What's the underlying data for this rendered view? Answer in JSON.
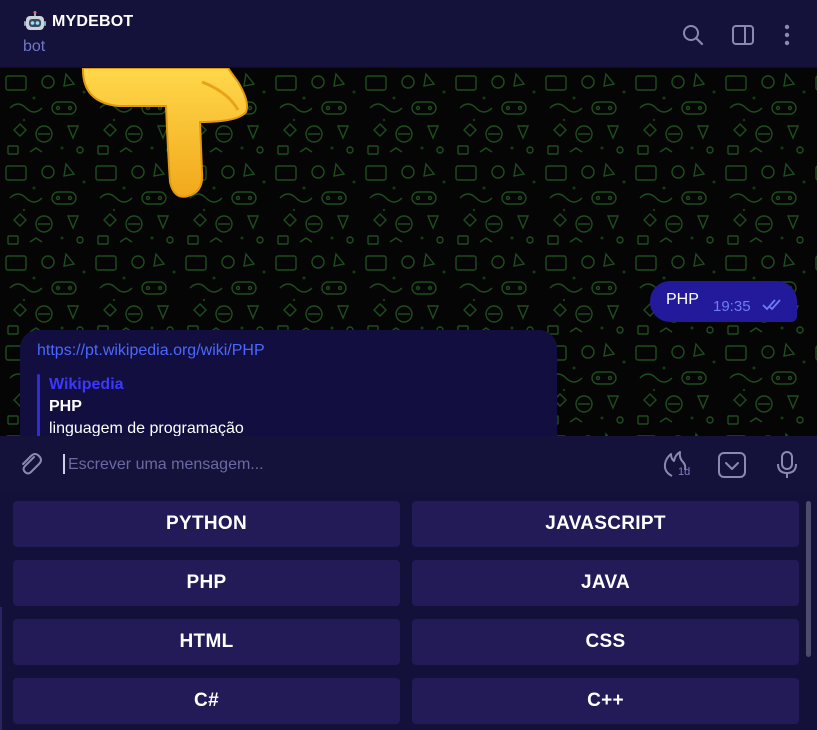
{
  "header": {
    "title": "MYDEBOT",
    "subtitle": "bot",
    "icons": [
      "robot-emoji",
      "search-icon",
      "sidebar-toggle-icon",
      "more-vertical-icon"
    ]
  },
  "chat": {
    "outgoing": {
      "text": "PHP",
      "time": "19:35",
      "status": "read"
    },
    "incoming": {
      "link": "https://pt.wikipedia.org/wiki/PHP",
      "preview_site": "Wikipedia",
      "preview_title": "PHP",
      "preview_description": "linguagem de programação"
    }
  },
  "composer": {
    "placeholder": "Escrever uma mensagem...",
    "timer_label": "1d",
    "icons": [
      "paperclip-icon",
      "self-destruct-timer-icon",
      "bot-keyboard-icon",
      "microphone-icon"
    ]
  },
  "keyboard": {
    "buttons": [
      "PYTHON",
      "JAVASCRIPT",
      "PHP",
      "JAVA",
      "HTML",
      "CSS",
      "C#",
      "C++"
    ]
  },
  "colors": {
    "header_bg": "#14123a",
    "outgoing_bubble": "#221a9b",
    "incoming_bubble": "#120f40",
    "link": "#4a68ff",
    "keyboard_button": "#231a58",
    "accent_subtitle": "#6f78c9"
  }
}
